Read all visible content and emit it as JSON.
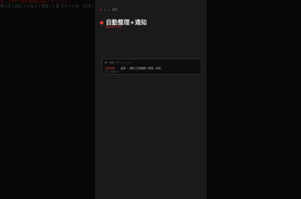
{
  "background": {
    "left_line_1": "出して漏れ! 複の詳細な設置・グローバル",
    "left_line_2": "現 | 仕 | 対応 ミスなど | 管理 | 1 進 コメントは、「必ず | 発生」"
  },
  "phone": {
    "status_label": "案内",
    "title": "自動整理+通知",
    "subtitle": "自動整理+通知",
    "panel_header": "手順 | ステップ 1 → 3",
    "panel_row_tag": "自動整理",
    "panel_row_text": "記録 ・ 通知 (日常業務 / 整理 / 共有)",
    "panel_sub": "設定 / 準備 完了"
  },
  "colors": {
    "accent": "#d4382a",
    "background": "#0a0a0a",
    "phone_bg": "#1a1a1a"
  }
}
